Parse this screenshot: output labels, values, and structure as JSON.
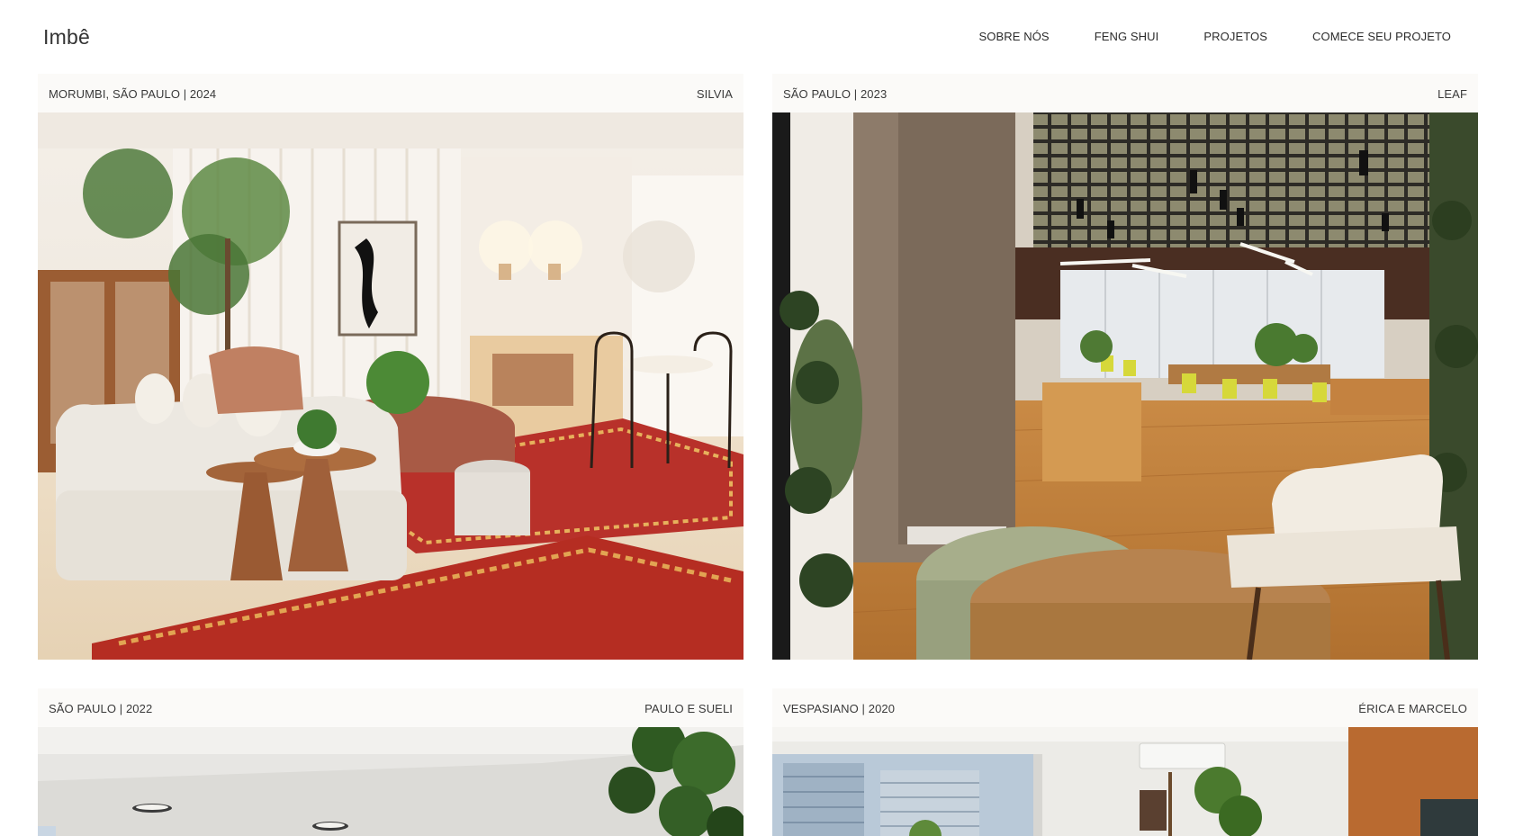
{
  "brand": {
    "logo": "Imbê"
  },
  "nav": {
    "items": [
      "SOBRE NÓS",
      "FENG SHUI",
      "PROJETOS",
      "COMECE SEU PROJETO"
    ]
  },
  "projects": [
    {
      "location": "MORUMBI, SÃO PAULO | 2024",
      "client": "SILVIA"
    },
    {
      "location": "SÃO PAULO | 2023",
      "client": "LEAF"
    },
    {
      "location": "SÃO PAULO | 2022",
      "client": "PAULO E SUELI"
    },
    {
      "location": "VESPASIANO | 2020",
      "client": "ÉRICA E MARCELO"
    }
  ],
  "colors": {
    "background": "#ffffff",
    "card_meta_bg": "#fbfaf8",
    "text": "#2b2b2b"
  }
}
